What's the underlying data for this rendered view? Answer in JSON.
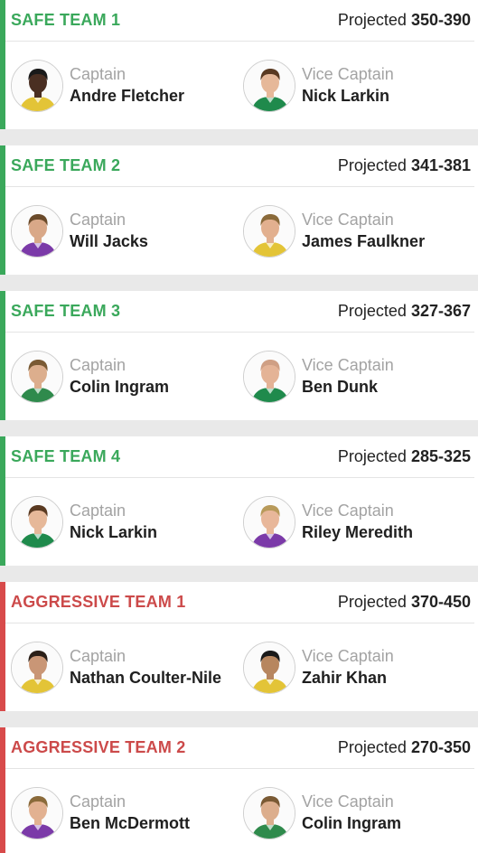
{
  "projected_label": "Projected",
  "captain_label": "Captain",
  "vice_captain_label": "Vice Captain",
  "colors": {
    "safe": "#3aa85b",
    "aggressive": "#d84a4a"
  },
  "teams": [
    {
      "name": "SAFE TEAM 1",
      "type": "safe",
      "range": "350-390",
      "captain": {
        "name": "Andre Fletcher",
        "skin": "#4a2f22",
        "hair": "#1a1a1a",
        "kit": "#e3c437"
      },
      "vice": {
        "name": "Nick Larkin",
        "skin": "#e6b899",
        "hair": "#5a3a22",
        "kit": "#1f8a4c"
      }
    },
    {
      "name": "SAFE TEAM 2",
      "type": "safe",
      "range": "341-381",
      "captain": {
        "name": "Will Jacks",
        "skin": "#d9a888",
        "hair": "#6a4a2a",
        "kit": "#7b3aa8"
      },
      "vice": {
        "name": "James Faulkner",
        "skin": "#e2b08f",
        "hair": "#8a6a3a",
        "kit": "#e3c437"
      }
    },
    {
      "name": "SAFE TEAM 3",
      "type": "safe",
      "range": "327-367",
      "captain": {
        "name": "Colin Ingram",
        "skin": "#dcae8d",
        "hair": "#7a5a34",
        "kit": "#2f8a4c"
      },
      "vice": {
        "name": "Ben Dunk",
        "skin": "#e4b396",
        "hair": "#cf9f84",
        "kit": "#1f8a4c"
      }
    },
    {
      "name": "SAFE TEAM 4",
      "type": "safe",
      "range": "285-325",
      "captain": {
        "name": "Nick Larkin",
        "skin": "#e6b899",
        "hair": "#5a3a22",
        "kit": "#1f8a4c"
      },
      "vice": {
        "name": "Riley Meredith",
        "skin": "#e8b79a",
        "hair": "#b89a5a",
        "kit": "#7b3aa8"
      }
    },
    {
      "name": "AGGRESSIVE TEAM 1",
      "type": "aggressive",
      "range": "370-450",
      "captain": {
        "name": "Nathan Coulter-Nile",
        "skin": "#c99676",
        "hair": "#2a1f18",
        "kit": "#e3c437"
      },
      "vice": {
        "name": "Zahir Khan",
        "skin": "#b7865f",
        "hair": "#1a1a1a",
        "kit": "#e3c437"
      }
    },
    {
      "name": "AGGRESSIVE TEAM 2",
      "type": "aggressive",
      "range": "270-350",
      "captain": {
        "name": "Ben McDermott",
        "skin": "#e2b191",
        "hair": "#8a6a3a",
        "kit": "#7b3aa8"
      },
      "vice": {
        "name": "Colin Ingram",
        "skin": "#dcae8d",
        "hair": "#7a5a34",
        "kit": "#2f8a4c"
      }
    }
  ]
}
